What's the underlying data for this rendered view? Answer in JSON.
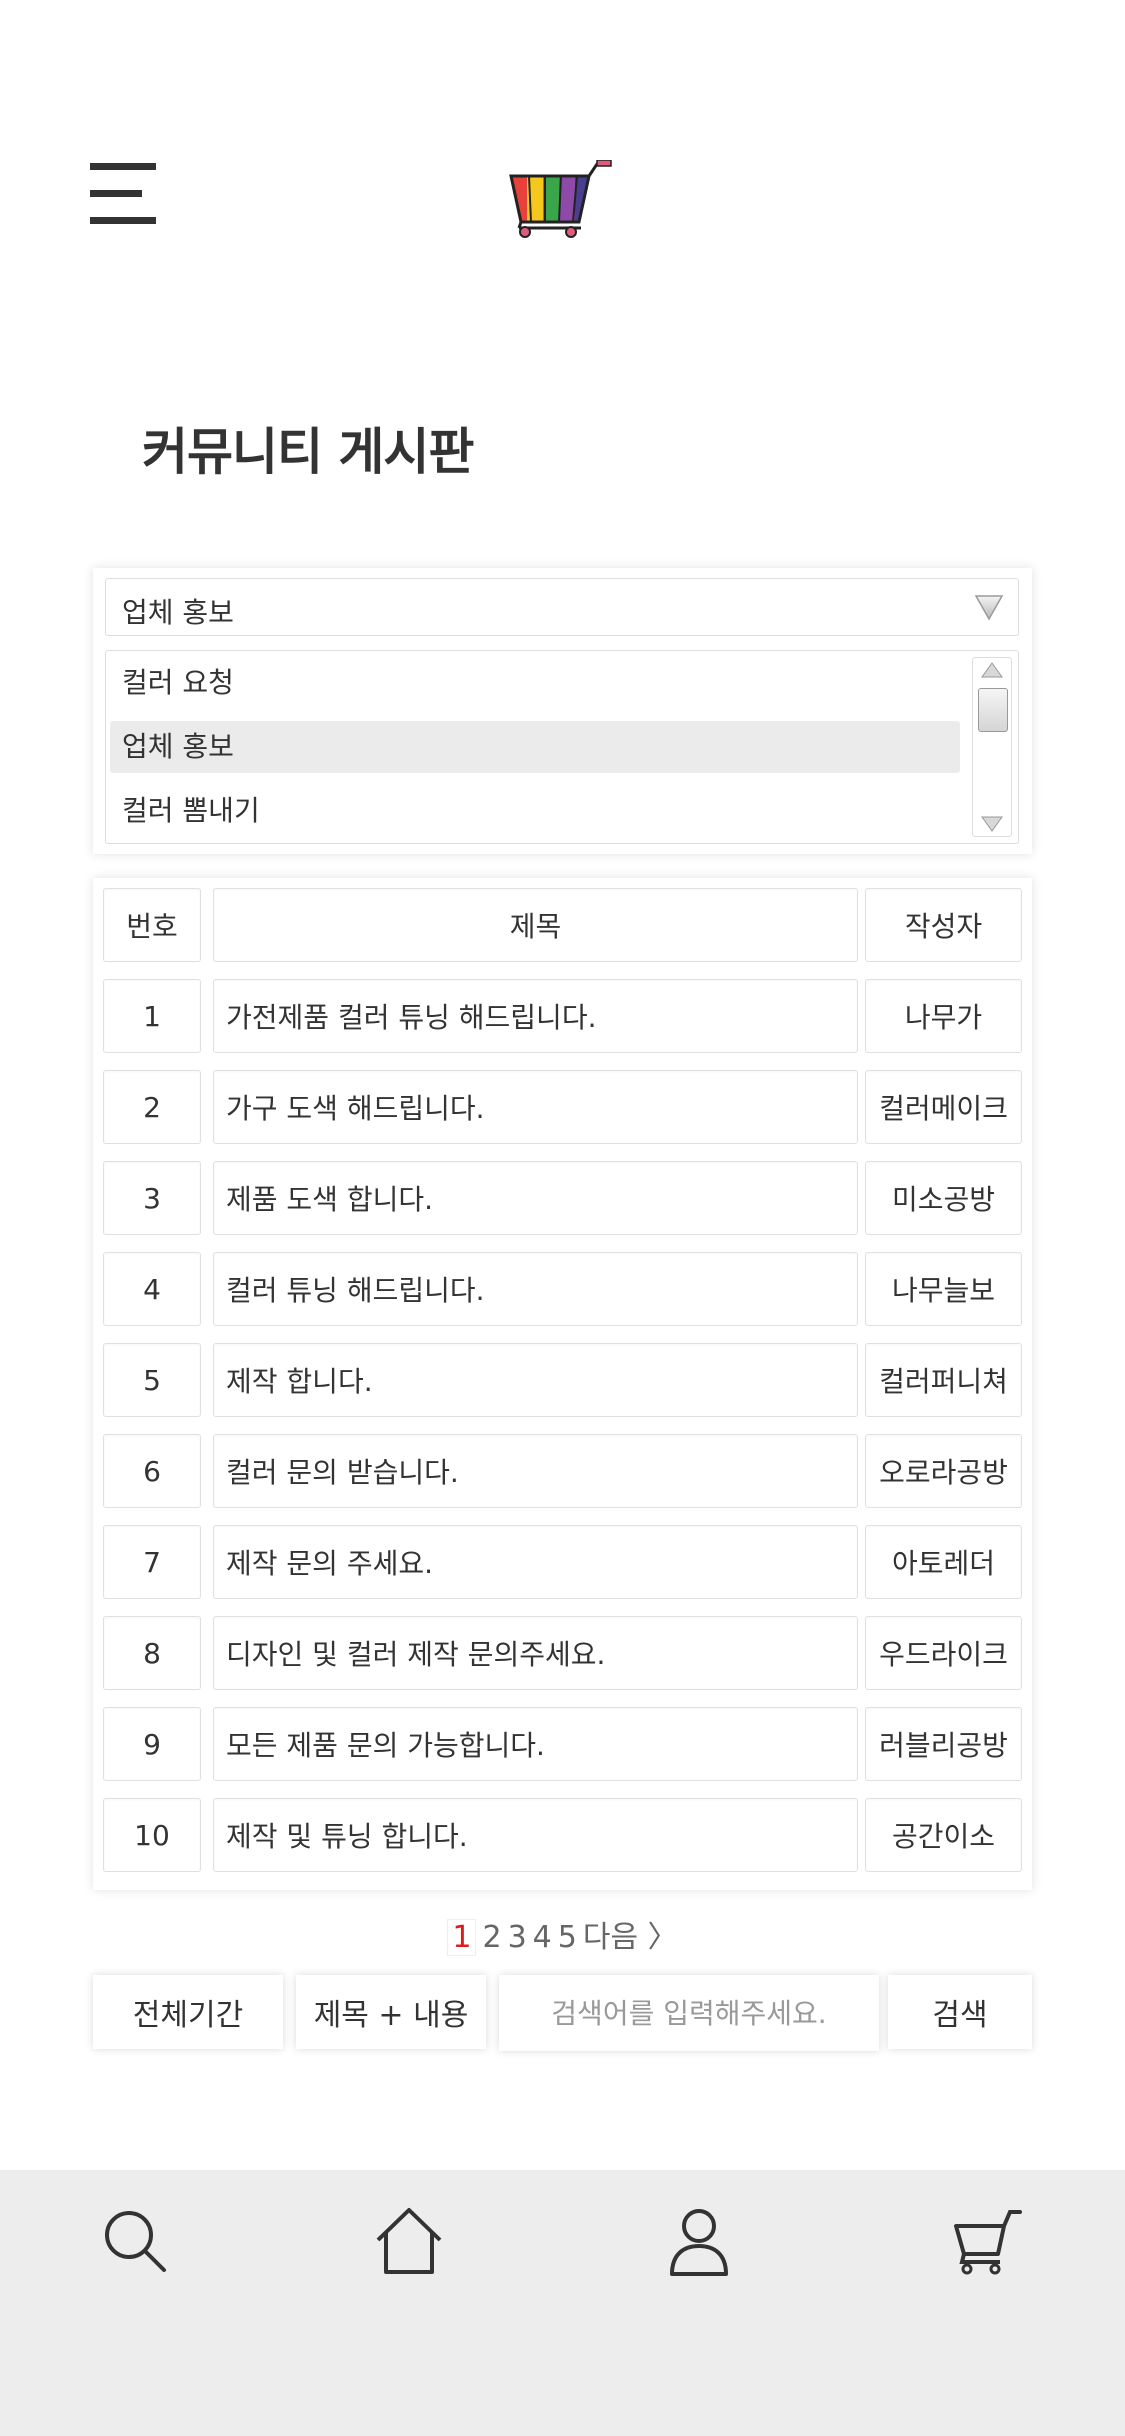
{
  "header": {
    "menu_icon": "hamburger-menu-icon",
    "logo_icon": "rainbow-cart-logo",
    "logo_colors": [
      "#e8413a",
      "#f6c71d",
      "#3aa64b",
      "#8e4aa8",
      "#4a3f8f"
    ]
  },
  "page": {
    "title": "커뮤니티 게시판"
  },
  "category": {
    "selected": "업체 홍보",
    "options": [
      "컬러 요청",
      "업체 홍보",
      "컬러 뽐내기"
    ]
  },
  "table": {
    "headers": {
      "num": "번호",
      "title": "제목",
      "author": "작성자"
    },
    "rows": [
      {
        "num": "1",
        "title": "가전제품 컬러 튜닝 해드립니다.",
        "author": "나무가"
      },
      {
        "num": "2",
        "title": "가구 도색 해드립니다.",
        "author": "컬러메이크"
      },
      {
        "num": "3",
        "title": "제품 도색 합니다.",
        "author": "미소공방"
      },
      {
        "num": "4",
        "title": "컬러 튜닝 해드립니다.",
        "author": "나무늘보"
      },
      {
        "num": "5",
        "title": "제작 합니다.",
        "author": "컬러퍼니쳐"
      },
      {
        "num": "6",
        "title": "컬러 문의 받습니다.",
        "author": "오로라공방"
      },
      {
        "num": "7",
        "title": "제작 문의 주세요.",
        "author": "아토레더"
      },
      {
        "num": "8",
        "title": "디자인 및 컬러 제작 문의주세요.",
        "author": "우드라이크"
      },
      {
        "num": "9",
        "title": "모든 제품 문의 가능합니다.",
        "author": "러블리공방"
      },
      {
        "num": "10",
        "title": "제작 및 튜닝 합니다.",
        "author": "공간이소"
      }
    ]
  },
  "pagination": {
    "pages": [
      "1",
      "2",
      "3",
      "4",
      "5"
    ],
    "current": "1",
    "next_label": "다음"
  },
  "search": {
    "period_label": "전체기간",
    "scope_label": "제목 + 내용",
    "placeholder": "검색어를 입력해주세요.",
    "button_label": "검색"
  },
  "bottom_nav": {
    "icons": [
      "search-icon",
      "home-icon",
      "user-icon",
      "cart-icon"
    ]
  },
  "colors": {
    "accent_page": "#e01b1b",
    "nav_bg": "#ededed"
  }
}
